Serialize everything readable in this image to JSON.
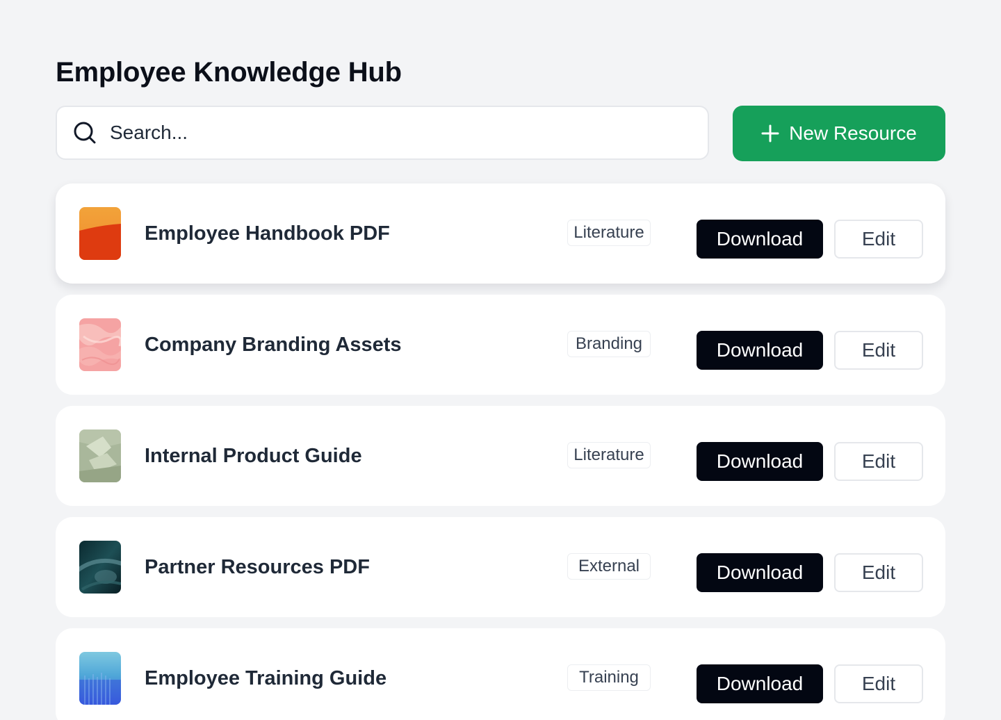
{
  "page": {
    "title": "Employee Knowledge Hub"
  },
  "search": {
    "placeholder": "Search...",
    "value": "",
    "icon": "search-icon"
  },
  "toolbar": {
    "new_button_label": "New Resource",
    "new_button_icon": "plus-icon",
    "accent_color": "#16a05a"
  },
  "resources": [
    {
      "name": "Employee Handbook PDF",
      "tag": "Literature",
      "download_label": "Download",
      "edit_label": "Edit",
      "thumbnail": "orange-red-gradient-thumbnail",
      "selected": true
    },
    {
      "name": "Company Branding Assets",
      "tag": "Branding",
      "download_label": "Download",
      "edit_label": "Edit",
      "thumbnail": "pink-marble-thumbnail",
      "selected": false
    },
    {
      "name": "Internal Product Guide",
      "tag": "Literature",
      "download_label": "Download",
      "edit_label": "Edit",
      "thumbnail": "sage-green-shapes-thumbnail",
      "selected": false
    },
    {
      "name": "Partner Resources PDF",
      "tag": "External",
      "download_label": "Download",
      "edit_label": "Edit",
      "thumbnail": "dark-teal-abstract-thumbnail",
      "selected": false
    },
    {
      "name": "Employee Training Guide",
      "tag": "Training",
      "download_label": "Download",
      "edit_label": "Edit",
      "thumbnail": "blue-gradient-thumbnail",
      "selected": false
    }
  ]
}
